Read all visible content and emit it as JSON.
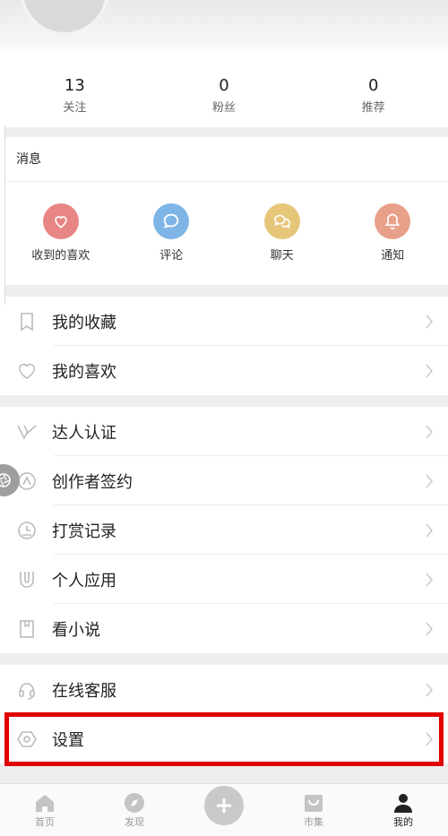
{
  "stats": [
    {
      "num": "13",
      "label": "关注"
    },
    {
      "num": "0",
      "label": "粉丝"
    },
    {
      "num": "0",
      "label": "推荐"
    }
  ],
  "messages": {
    "title": "消息",
    "items": [
      {
        "label": "收到的喜欢",
        "icon": "heart-icon",
        "color": "#e88585"
      },
      {
        "label": "评论",
        "icon": "comment-icon",
        "color": "#7fb5e6"
      },
      {
        "label": "聊天",
        "icon": "chat-icon",
        "color": "#e6c77a"
      },
      {
        "label": "通知",
        "icon": "bell-icon",
        "color": "#e8a08a"
      }
    ]
  },
  "group1": [
    {
      "label": "我的收藏",
      "icon": "bookmark-icon"
    },
    {
      "label": "我的喜欢",
      "icon": "heart-outline-icon"
    }
  ],
  "group2": [
    {
      "label": "达人认证",
      "icon": "v-badge-icon"
    },
    {
      "label": "创作者签约",
      "icon": "creator-icon"
    },
    {
      "label": "打赏记录",
      "icon": "reward-clock-icon"
    },
    {
      "label": "个人应用",
      "icon": "u-app-icon"
    },
    {
      "label": "看小说",
      "icon": "book-icon"
    }
  ],
  "group3": [
    {
      "label": "在线客服",
      "icon": "headset-icon"
    },
    {
      "label": "设置",
      "icon": "settings-hexagon-icon"
    }
  ],
  "tabbar": [
    {
      "label": "首页",
      "icon": "home-icon",
      "active": false
    },
    {
      "label": "发现",
      "icon": "compass-icon",
      "active": false
    },
    {
      "label": "",
      "icon": "plus-icon",
      "active": false
    },
    {
      "label": "市集",
      "icon": "shopping-bag-icon",
      "active": false
    },
    {
      "label": "我的",
      "icon": "user-icon",
      "active": true
    }
  ],
  "colors": {
    "highlight": "#e00000",
    "active_tab": "#222222",
    "inactive_tab": "#999999"
  }
}
